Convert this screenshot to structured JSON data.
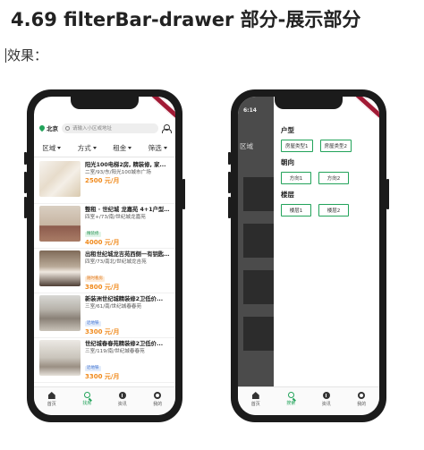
{
  "doc": {
    "title": "4.69 filterBar-drawer 部分-展示部分",
    "effect_label": "效果："
  },
  "left_phone": {
    "location": "北京",
    "search_placeholder": "请输入小区或地址",
    "filters": [
      "区域",
      "方式",
      "租金",
      "筛选"
    ],
    "houses": [
      {
        "title": "阳光100电梯2房, 精装修, 家...",
        "desc": "二室/93/东/阳光100城市广场",
        "tag": "",
        "tag_color": "",
        "price": "2500 元/月"
      },
      {
        "title": "整租 · 世纪城 龙嘉苑 4+1户型...",
        "desc": "四室+/73/南/世纪城龙嘉苑",
        "tag": "精装修",
        "tag_color": "green",
        "price": "4000 元/月"
      },
      {
        "title": "出租世纪城龙吉苑西侧一有钥匙...",
        "desc": "四室/73/南北/世纪城龙吉苑",
        "tag": "随时看房",
        "tag_color": "orange",
        "price": "3800 元/月"
      },
      {
        "title": "新装洲世纪城精装修2卫低价...",
        "desc": "三室/61/南/世纪城春春苑",
        "tag": "近地铁",
        "tag_color": "blue",
        "price": "3300 元/月"
      },
      {
        "title": "世纪城春春苑精装修2卫低价...",
        "desc": "三室/119/南/世纪城春春苑",
        "tag": "近地铁",
        "tag_color": "blue",
        "price": "3300 元/月"
      }
    ],
    "tabs": [
      {
        "label": "首页",
        "icon": "home-icon",
        "active": false
      },
      {
        "label": "找房",
        "icon": "search-icon",
        "active": true
      },
      {
        "label": "资讯",
        "icon": "info-icon",
        "active": false
      },
      {
        "label": "我的",
        "icon": "user-icon",
        "active": false
      }
    ]
  },
  "right_phone": {
    "status_time": "6:14",
    "dim_filter": "区域",
    "sections": [
      {
        "title": "户型",
        "options": [
          "房屋类型1",
          "房屋类型2"
        ]
      },
      {
        "title": "朝向",
        "options": [
          "方向1",
          "方向2"
        ]
      },
      {
        "title": "楼层",
        "options": [
          "楼层1",
          "楼层2"
        ]
      }
    ],
    "tabs": [
      {
        "label": "首页",
        "icon": "home-icon",
        "active": false
      },
      {
        "label": "搜索",
        "icon": "search-icon",
        "active": true
      },
      {
        "label": "资讯",
        "icon": "info-icon",
        "active": false
      },
      {
        "label": "我的",
        "icon": "user-icon",
        "active": false
      }
    ]
  },
  "colors": {
    "accent": "#22a35a",
    "price": "#f08a1c",
    "frame": "#1b1b1b"
  }
}
